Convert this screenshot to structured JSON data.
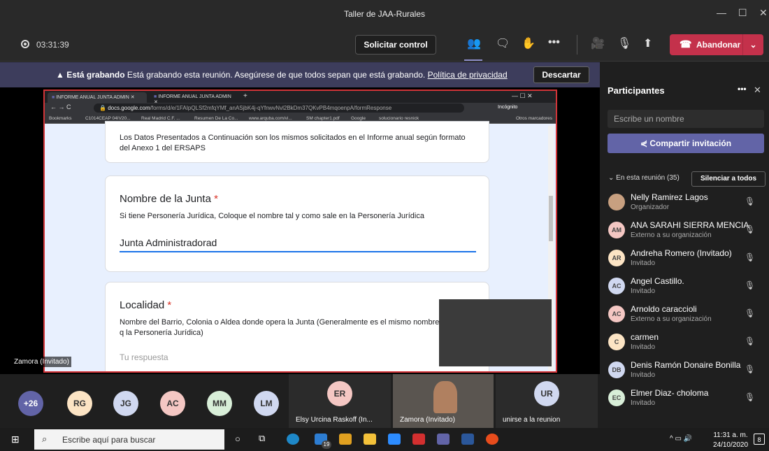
{
  "window": {
    "title": "Taller de JAA-Rurales"
  },
  "toolbar": {
    "timer": "03:31:39",
    "request_control": "Solicitar control",
    "leave": "Abandonar"
  },
  "recording_banner": {
    "bold": "Está grabando",
    "text": " Está grabando esta reunión. Asegúrese de que todos sepan que está grabando. ",
    "link": "Política de privacidad",
    "dismiss": "Descartar"
  },
  "shared_browser": {
    "tab1": "INFORME ANUAL JUNTA ADMIN",
    "tab2": "INFORME ANUAL JUNTA ADMIN",
    "url_host": "docs.google.com",
    "url_path": "/forms/d/e/1FAIpQLSf2mfqYMf_anASjbK4j-qYfnwvNvl2BkDm37QKvPB4mqoenpA/formResponse",
    "incognito": "Incógnito",
    "bookmarks": [
      "Bookmarks",
      "C1014CEAP 04IV20...",
      "Real Madrid C.F. ...",
      "Resumen De La Co...",
      "www.arquba.com/vi...",
      "SM chapter1.pdf",
      "Google",
      "solucionario resnick",
      "Otros marcadores"
    ]
  },
  "form": {
    "intro": "Los Datos Presentados a Continuación son los mismos solicitados en el Informe anual según formato del Anexo 1 del ERSAPS",
    "q1_title": "Nombre de la Junta",
    "q1_desc": "Si tiene Personería Jurídica, Coloque el nombre tal y como sale en la Personería Jurídica",
    "q1_value": "Junta Administradorad",
    "q2_title": "Localidad",
    "q2_desc": "Nombre del Barrio, Colonia o Aldea donde opera la Junta (Generalmente es el mismo nombre q la Personería Jurídica)",
    "q2_placeholder": "Tu respuesta",
    "required_mark": "*"
  },
  "stage_label": "Zamora (Invitado)",
  "participants_panel": {
    "title": "Participantes",
    "search_placeholder": "Escribe un nombre",
    "invite": "Compartir invitación",
    "section": "En esta reunión (35)",
    "mute_all": "Silenciar a todos",
    "people": [
      {
        "initials": "",
        "name": "Nelly Ramirez Lagos",
        "role": "Organizador",
        "color": "#c8a080"
      },
      {
        "initials": "AM",
        "name": "ANA SARAHI SIERRA MENCIA",
        "role": "Externo a su organización",
        "color": "#f4c7c3"
      },
      {
        "initials": "AR",
        "name": "Andreha Romero (Invitado)",
        "role": "Invitado",
        "color": "#fce4c4"
      },
      {
        "initials": "AC",
        "name": "Angel Castillo.",
        "role": "Invitado",
        "color": "#d0d8f0"
      },
      {
        "initials": "AC",
        "name": "Arnoldo caraccioli",
        "role": "Externo a su organización",
        "color": "#f4c7c3"
      },
      {
        "initials": "C",
        "name": "carmen",
        "role": "Invitado",
        "color": "#fce4c4"
      },
      {
        "initials": "DB",
        "name": "Denis Ramón Donaire Bonilla",
        "role": "Invitado",
        "color": "#d0d8f0"
      },
      {
        "initials": "EC",
        "name": "Elmer Diaz- choloma",
        "role": "Invitado",
        "color": "#d8eed8"
      }
    ]
  },
  "strip": {
    "more": "+26",
    "avatars": [
      {
        "initials": "RG",
        "color": "#fce4c4"
      },
      {
        "initials": "JG",
        "color": "#d0d8f0"
      },
      {
        "initials": "AC",
        "color": "#f4c7c3"
      },
      {
        "initials": "MM",
        "color": "#d8eed8"
      },
      {
        "initials": "LM",
        "color": "#d0d8f0"
      }
    ],
    "tile1": {
      "initials": "ER",
      "label": "Elsy Urcina Raskoff (In..."
    },
    "tile2": {
      "label": "Zamora (Invitado)"
    },
    "tile3": {
      "initials": "UR",
      "label": "unirse a la reunion"
    }
  },
  "taskbar": {
    "search": "Escribe aquí para buscar",
    "time": "11:31 a. m.",
    "date": "24/10/2020",
    "badge_store": "19",
    "notif": "8"
  }
}
